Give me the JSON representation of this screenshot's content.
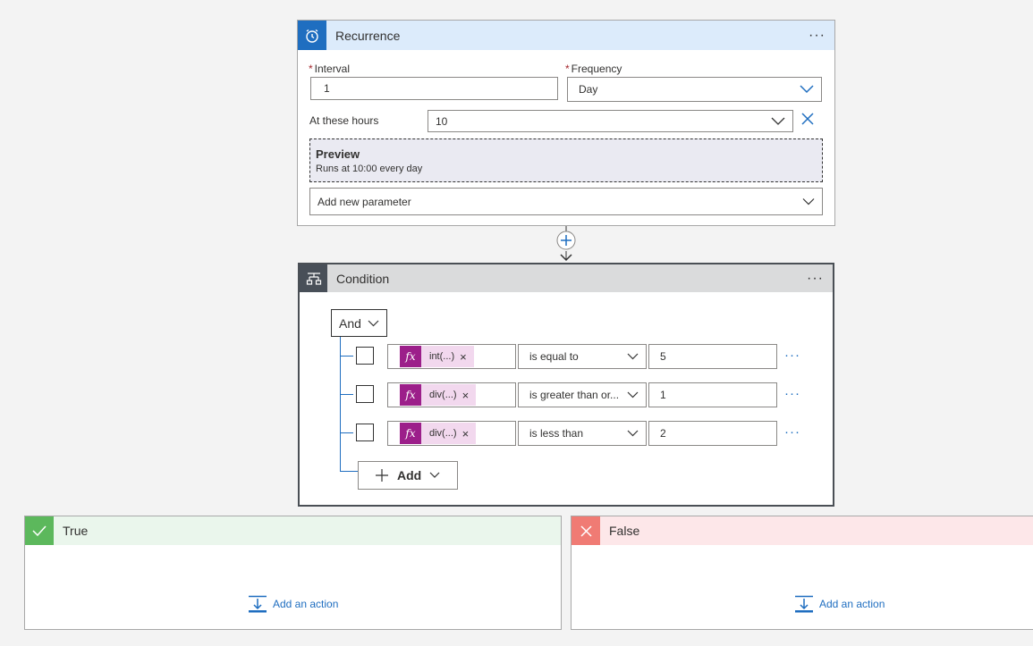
{
  "recurrence": {
    "title": "Recurrence",
    "interval_label": "Interval",
    "interval_value": "1",
    "frequency_label": "Frequency",
    "frequency_value": "Day",
    "hours_label": "At these hours",
    "hours_value": "10",
    "preview_title": "Preview",
    "preview_text": "Runs at 10:00 every day",
    "add_param_label": "Add new parameter",
    "required_mark": "*",
    "more_label": "···"
  },
  "condition": {
    "title": "Condition",
    "group_operator": "And",
    "more_label": "···",
    "rows": [
      {
        "token": "int(...)",
        "operator": "is equal to",
        "value": "5"
      },
      {
        "token": "div(...)",
        "operator": "is greater than or...",
        "value": "1"
      },
      {
        "token": "div(...)",
        "operator": "is less than",
        "value": "2"
      }
    ],
    "token_icon": "fx",
    "token_remove": "×",
    "row_more": "···",
    "add_label": "Add"
  },
  "branches": {
    "true": {
      "title": "True",
      "add_action": "Add an action",
      "color": "#5cb85c"
    },
    "false": {
      "title": "False",
      "add_action": "Add an action",
      "color": "#f07b74"
    }
  },
  "colors": {
    "accent": "#1f6ec0",
    "recurrence_header": "#dcebfb",
    "condition_header": "#dadbdc",
    "true_header": "#eaf6ec",
    "false_header": "#fde7e9",
    "fx_token": "#9c1f8a"
  }
}
